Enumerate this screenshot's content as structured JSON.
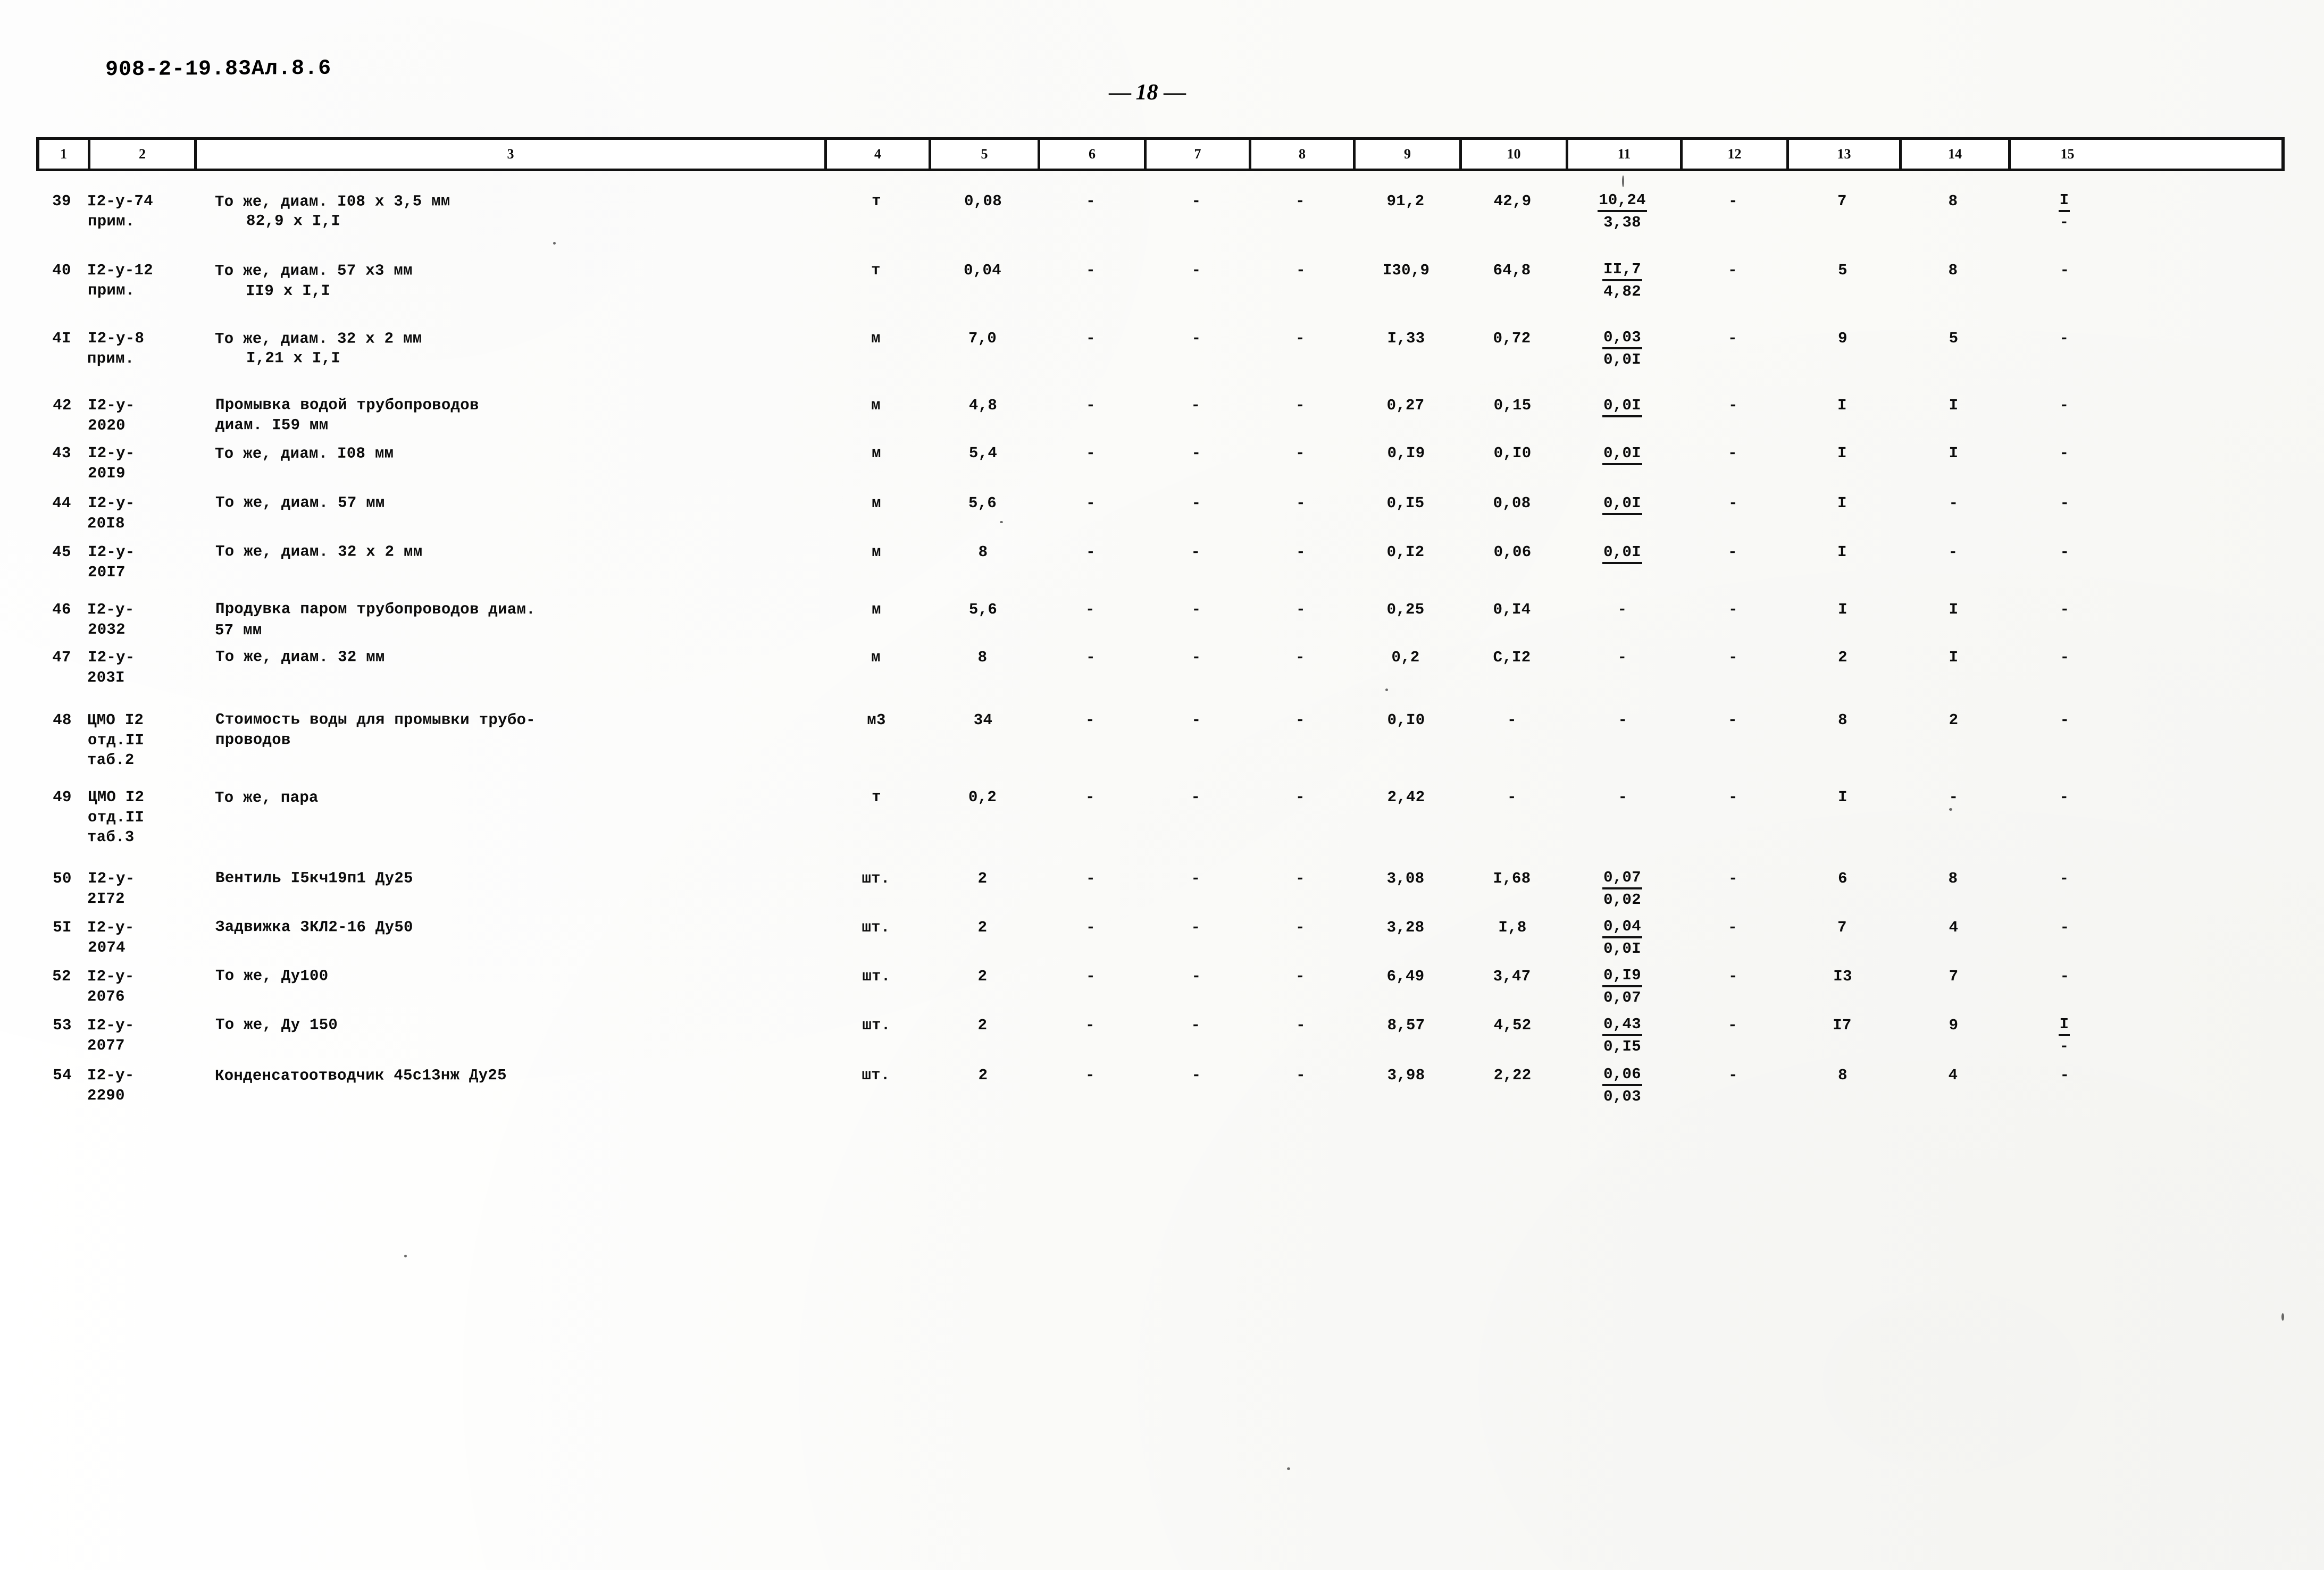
{
  "document": {
    "code": "908-2-19.83Ал.8.6",
    "page_label_prefix": "—",
    "page_number": "18",
    "page_label_suffix": "—"
  },
  "table": {
    "column_headers": [
      "1",
      "2",
      "3",
      "4",
      "5",
      "6",
      "7",
      "8",
      "9",
      "10",
      "11",
      "12",
      "13",
      "14",
      "15"
    ],
    "rows": [
      {
        "c1": "39",
        "c2": "I2-у-74",
        "c2b": "прим.",
        "c3": "То же, диам. I08 x 3,5 мм",
        "c3b": "82,9 x I,I",
        "c4": "т",
        "c5": "0,08",
        "c6": "-",
        "c7": "-",
        "c8": "-",
        "c9": "91,2",
        "c10": "42,9",
        "c11_num": "10,24",
        "c11_den": "3,38",
        "c12": "-",
        "c13": "7",
        "c14": "8",
        "c15_num": "I",
        "c15_den": "-"
      },
      {
        "c1": "40",
        "c2": "I2-у-12",
        "c2b": "прим.",
        "c3": "То же, диам. 57 x3 мм",
        "c3b": "II9 x I,I",
        "c4": "т",
        "c5": "0,04",
        "c6": "-",
        "c7": "-",
        "c8": "-",
        "c9": "I30,9",
        "c10": "64,8",
        "c11_num": "II,7",
        "c11_den": "4,82",
        "c12": "-",
        "c13": "5",
        "c14": "8",
        "c15": "-"
      },
      {
        "c1": "4I",
        "c2": "I2-у-8",
        "c2b": "прим.",
        "c3": "То же, диам. 32 x 2 мм",
        "c3b": "I,21 x I,I",
        "c4": "м",
        "c5": "7,0",
        "c6": "-",
        "c7": "-",
        "c8": "-",
        "c9": "I,33",
        "c10": "0,72",
        "c11_num": "0,03",
        "c11_den": "0,0I",
        "c12": "-",
        "c13": "9",
        "c14": "5",
        "c15": "-"
      },
      {
        "c1": "42",
        "c2": "I2-у-",
        "c2b": "2020",
        "c3": "Промывка водой трубопроводов",
        "c3b": "диам. I59 мм",
        "c4": "м",
        "c5": "4,8",
        "c6": "-",
        "c7": "-",
        "c8": "-",
        "c9": "0,27",
        "c10": "0,15",
        "c11_num": "0,0I",
        "c11_den": "",
        "c12": "-",
        "c13": "I",
        "c14": "I",
        "c15": "-"
      },
      {
        "c1": "43",
        "c2": "I2-у-",
        "c2b": "20I9",
        "c3": "То же, диам. I08 мм",
        "c3b": "",
        "c4": "м",
        "c5": "5,4",
        "c6": "-",
        "c7": "-",
        "c8": "-",
        "c9": "0,I9",
        "c10": "0,I0",
        "c11_num": "0,0I",
        "c11_den": "",
        "c12": "-",
        "c13": "I",
        "c14": "I",
        "c15": "-"
      },
      {
        "c1": "44",
        "c2": "I2-у-",
        "c2b": "20I8",
        "c3": "То же, диам. 57 мм",
        "c3b": "",
        "c4": "м",
        "c5": "5,6",
        "c6": "-",
        "c7": "-",
        "c8": "-",
        "c9": "0,I5",
        "c10": "0,08",
        "c11_num": "0,0I",
        "c11_den": "",
        "c12": "-",
        "c13": "I",
        "c14": "-",
        "c15": "-"
      },
      {
        "c1": "45",
        "c2": "I2-у-",
        "c2b": "20I7",
        "c3": "То же, диам. 32 x 2 мм",
        "c3b": "",
        "c4": "м",
        "c5": "8",
        "c6": "-",
        "c7": "-",
        "c8": "-",
        "c9": "0,I2",
        "c10": "0,06",
        "c11_num": "0,0I",
        "c11_den": "",
        "c12": "-",
        "c13": "I",
        "c14": "-",
        "c15": "-"
      },
      {
        "c1": "46",
        "c2": "I2-у-",
        "c2b": "2032",
        "c3": "Продувка паром трубопроводов диам.",
        "c3b": "57 мм",
        "c4": "м",
        "c5": "5,6",
        "c6": "-",
        "c7": "-",
        "c8": "-",
        "c9": "0,25",
        "c10": "0,I4",
        "c11": "-",
        "c12": "-",
        "c13": "I",
        "c14": "I",
        "c15": "-"
      },
      {
        "c1": "47",
        "c2": "I2-у-",
        "c2b": "203I",
        "c3": "То же, диам. 32 мм",
        "c3b": "",
        "c4": "м",
        "c5": "8",
        "c6": "-",
        "c7": "-",
        "c8": "-",
        "c9": "0,2",
        "c10": "С,I2",
        "c11": "-",
        "c12": "-",
        "c13": "2",
        "c14": "I",
        "c15": "-"
      },
      {
        "c1": "48",
        "c2": "ЦМО I2",
        "c2b": "отд.II",
        "c2c": "таб.2",
        "c3": "Стоимость воды для промывки трубо-",
        "c3b": "проводов",
        "c4": "м3",
        "c5": "34",
        "c6": "-",
        "c7": "-",
        "c8": "-",
        "c9": "0,I0",
        "c10": "-",
        "c11": "-",
        "c12": "-",
        "c13": "8",
        "c14": "2",
        "c15": "-"
      },
      {
        "c1": "49",
        "c2": "ЦМО I2",
        "c2b": "отд.II",
        "c2c": "таб.3",
        "c3": "То же, пара",
        "c3b": "",
        "c4": "т",
        "c5": "0,2",
        "c6": "-",
        "c7": "-",
        "c8": "-",
        "c9": "2,42",
        "c10": "-",
        "c11": "-",
        "c12": "-",
        "c13": "I",
        "c14": "-",
        "c15": "-"
      },
      {
        "c1": "50",
        "c2": "I2-у-",
        "c2b": "2I72",
        "c3": "Вентиль I5кч19п1 Ду25",
        "c3b": "",
        "c4": "шт.",
        "c5": "2",
        "c6": "-",
        "c7": "-",
        "c8": "-",
        "c9": "3,08",
        "c10": "I,68",
        "c11_num": "0,07",
        "c11_den": "0,02",
        "c12": "-",
        "c13": "6",
        "c14": "8",
        "c15": "-"
      },
      {
        "c1": "5I",
        "c2": "I2-у-",
        "c2b": "2074",
        "c3": "Задвижка 3КЛ2-16 Ду50",
        "c3b": "",
        "c4": "шт.",
        "c5": "2",
        "c6": "-",
        "c7": "-",
        "c8": "-",
        "c9": "3,28",
        "c10": "I,8",
        "c11_num": "0,04",
        "c11_den": "0,0I",
        "c12": "-",
        "c13": "7",
        "c14": "4",
        "c15": "-"
      },
      {
        "c1": "52",
        "c2": "I2-у-",
        "c2b": "2076",
        "c3": "То же, Ду100",
        "c3b": "",
        "c4": "шт.",
        "c5": "2",
        "c6": "-",
        "c7": "-",
        "c8": "-",
        "c9": "6,49",
        "c10": "3,47",
        "c11_num": "0,I9",
        "c11_den": "0,07",
        "c12": "-",
        "c13": "I3",
        "c14": "7",
        "c15": "-"
      },
      {
        "c1": "53",
        "c2": "I2-у-",
        "c2b": "2077",
        "c3": "То же, Ду 150",
        "c3b": "",
        "c4": "шт.",
        "c5": "2",
        "c6": "-",
        "c7": "-",
        "c8": "-",
        "c9": "8,57",
        "c10": "4,52",
        "c11_num": "0,43",
        "c11_den": "0,I5",
        "c12": "-",
        "c13": "I7",
        "c14": "9",
        "c15_num": "I",
        "c15_den": "-"
      },
      {
        "c1": "54",
        "c2": "I2-у-",
        "c2b": "2290",
        "c3": "Конденсатоотводчик 45с13нж Ду25",
        "c3b": "",
        "c4": "шт.",
        "c5": "2",
        "c6": "-",
        "c7": "-",
        "c8": "-",
        "c9": "3,98",
        "c10": "2,22",
        "c11_num": "0,06",
        "c11_den": "0,03",
        "c12": "-",
        "c13": "8",
        "c14": "4",
        "c15": "-"
      }
    ]
  }
}
